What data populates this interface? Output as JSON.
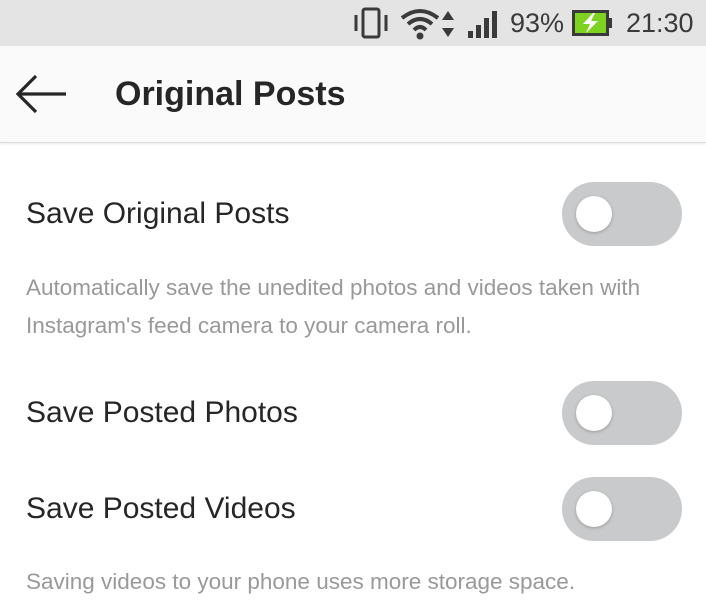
{
  "status_bar": {
    "battery_percent": "93%",
    "time": "21:30",
    "icons": [
      "vibrate-icon",
      "wifi-icon",
      "data-arrows-icon",
      "signal-icon",
      "battery-charging-icon"
    ],
    "battery_color": "#7ed321"
  },
  "header": {
    "title": "Original Posts",
    "back_icon": "arrow-left-icon"
  },
  "settings": [
    {
      "label": "Save Original Posts",
      "description": "Automatically save the unedited photos and videos taken with Instagram's feed camera to your camera roll.",
      "enabled": false
    },
    {
      "label": "Save Posted Photos",
      "enabled": false
    },
    {
      "label": "Save Posted Videos",
      "description": "Saving videos to your phone uses more storage space.",
      "enabled": false
    }
  ],
  "colors": {
    "toggle_off_track": "#c9cacb",
    "toggle_knob": "#ffffff",
    "primary_text": "#262626",
    "secondary_text": "#999999"
  }
}
